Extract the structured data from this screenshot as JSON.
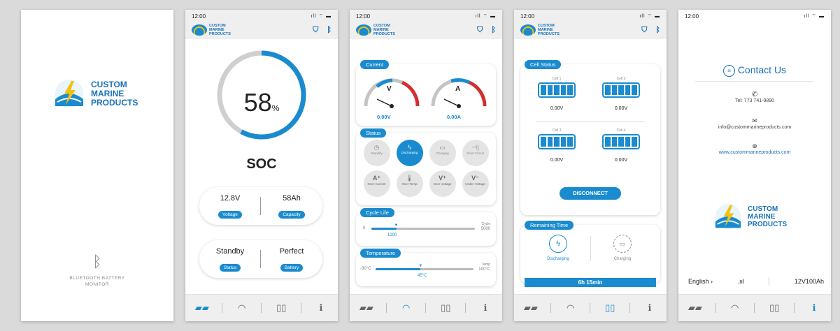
{
  "screen1": {
    "brand": [
      "CUSTOM",
      "MARINE",
      "PRODUCTS"
    ],
    "footer": "BLUETOOTH BATTERY MONITOR"
  },
  "statusbar": {
    "time": "12:00",
    "icons": "ıll ⌔ ▬"
  },
  "screen2": {
    "soc_value": "58",
    "soc_unit": "%",
    "soc_fraction": 0.58,
    "soc_label": "SOC",
    "voltage_value": "12.8V",
    "voltage_label": "Voltage",
    "capacity_value": "58Ah",
    "capacity_label": "Capacity",
    "status_value": "Standby",
    "status_label": "Status",
    "battery_value": "Perfect",
    "battery_label": "Battery"
  },
  "screen3": {
    "current_title": "Current",
    "volt_gauge_unit": "V",
    "amp_gauge_unit": "A",
    "volt_reading": "0.00V",
    "amp_reading": "0.00A",
    "status_title": "Status",
    "status_items": [
      "Standby",
      "Discharging",
      "Charging",
      "Short Circuit",
      "Over Current",
      "Over Temp",
      "Over Voltage",
      "Under Voltage"
    ],
    "cycle_title": "Cycle Life",
    "cycle_min": "0",
    "cycle_max_label": "Cycle",
    "cycle_max": "5000",
    "cycle_value": "1200",
    "temp_title": "Temperature",
    "temp_min": "-30°C",
    "temp_max_label": "Temp",
    "temp_max": "100°C",
    "temp_value": "45°C"
  },
  "screen4": {
    "cell_title": "Cell Status",
    "cells": [
      {
        "name": "Cell 1",
        "voltage": "0.00V"
      },
      {
        "name": "Cell 2",
        "voltage": "0.00V"
      },
      {
        "name": "Cell 3",
        "voltage": "0.00V"
      },
      {
        "name": "Cell 4",
        "voltage": "0.00V"
      }
    ],
    "disconnect": "DISCONNECT",
    "remaining_title": "Remaining Time",
    "discharging": "Discharging",
    "charging": "Charging",
    "remaining_value": "6h 15min"
  },
  "screen5": {
    "contact_title": "Contact Us",
    "tel": "Tel: 773 741-9890",
    "email": "info@custommarineproducts.com",
    "website": "www.custommarineproducts.com",
    "brand": [
      "CUSTOM",
      "MARINE",
      "PRODUCTS"
    ],
    "language": "English",
    "model": "12V100Ah"
  },
  "colors": {
    "accent": "#1a8bcf",
    "brand": "#1a72b8",
    "warn": "#d32f2f",
    "sun": "#f4c20d"
  }
}
